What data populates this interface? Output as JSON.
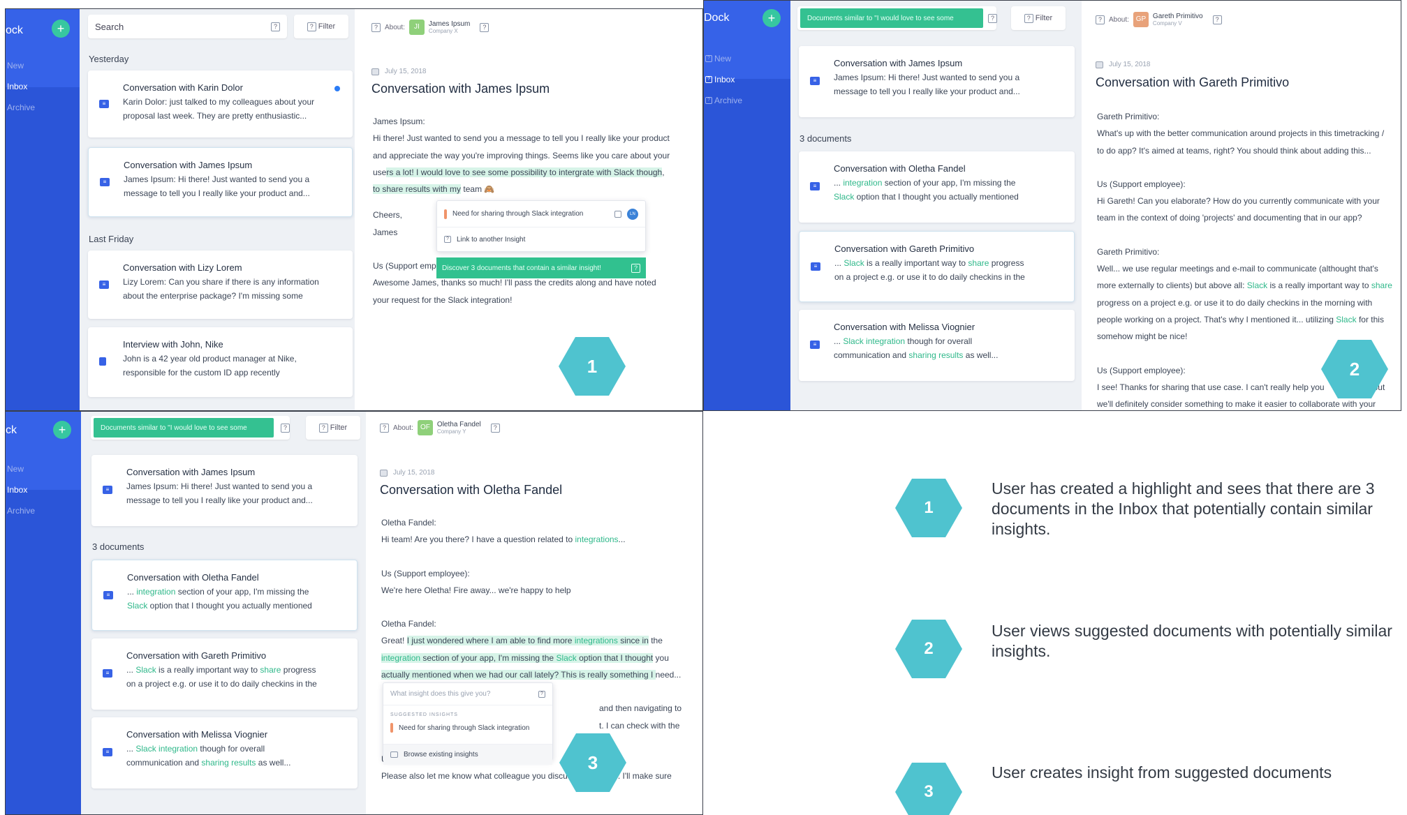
{
  "app": {
    "brand_p1": "ock",
    "brand_p2": "Dock",
    "brand_p3": "ck",
    "add_label": "+"
  },
  "nav": [
    "New",
    "Inbox",
    "Archive"
  ],
  "search": {
    "placeholder": "Search",
    "filter_label": "Filter",
    "similar_chip": "Documents similar to \"I would love to see some"
  },
  "colors": {
    "rail": "#2b55d8",
    "accent_green": "#37c7a0",
    "highlight": "#d7f4e8",
    "hex": "#4fc3cf"
  },
  "panel1": {
    "sections": [
      "Yesterday",
      "Last Friday"
    ],
    "cards": [
      {
        "title": "Conversation with Karin Dolor",
        "l1": "Karin Dolor: just talked to my colleagues about your",
        "l2": "proposal last week. They are pretty enthusiastic..."
      },
      {
        "title": "Conversation with James Ipsum",
        "l1": "James Ipsum: Hi there! Just wanted to send you a",
        "l2": "message to tell you I really like your product and..."
      },
      {
        "title": "Conversation with Lizy Lorem",
        "l1": "Lizy Lorem: Can you share if there is any information",
        "l2": "about the enterprise package? I'm missing some"
      },
      {
        "title": "Interview with John, Nike",
        "l1": "John is a 42 year old product manager at Nike,",
        "l2": "responsible for the custom ID app recently"
      }
    ],
    "about": {
      "label": "About:",
      "initials": "JI",
      "name": "James Ipsum",
      "company": "Company X"
    },
    "date": "July 15, 2018",
    "title": "Conversation with James Ipsum",
    "lines": {
      "a": "James Ipsum:",
      "b": "Hi there! Just wanted to send you a message to tell you I really like your product",
      "c": "and appreciate the way you're improving things. Seems like you care about your",
      "d1": "use",
      "d2": "rs a lot! I would love to see some possibility to intergrate with Slack though",
      "d3": ",",
      "e1": "to share results with my",
      "e2": " team 🙈",
      "f": "Cheers,",
      "g": "James",
      "h": "Us (Support employe",
      "i": "Awesome James, thanks so much! I'll pass the credits along and have noted",
      "j": "your request for the Slack integration!"
    },
    "popup": {
      "insight": "Need for sharing through Slack integration",
      "avatar": "LN",
      "link": "Link to another Insight",
      "discover": "Discover 3 documents  that contain a similar insight!"
    },
    "step": "1"
  },
  "panel2": {
    "section": "3 documents",
    "cards": [
      {
        "title": "Conversation with James Ipsum",
        "l1": "James Ipsum: Hi there! Just wanted to send you a",
        "l2": "message to tell you I really like your product and..."
      },
      {
        "title": "Conversation with Oletha Fandel",
        "l1a": "... ",
        "l1b": "integration",
        "l1c": " section of your app, I'm missing the",
        "l2a": "Slack",
        "l2b": " option that I thought you actually mentioned"
      },
      {
        "title": "Conversation with Gareth Primitivo",
        "l1a": "... ",
        "l1b": "Slack",
        "l1c": " is a really important way to ",
        "l1d": "share",
        "l1e": " progress",
        "l2": "on a project e.g. or use it to do daily checkins in the"
      },
      {
        "title": "Conversation with Melissa Viognier",
        "l1a": "... ",
        "l1b": "Slack integration",
        "l1c": " though for overall",
        "l2a": "communication and ",
        "l2b": "sharing results",
        "l2c": " as well..."
      }
    ],
    "about": {
      "label": "About:",
      "initials": "GP",
      "name": "Gareth Primitivo",
      "company": "Company V"
    },
    "date": "July 15, 2018",
    "title": "Conversation with Gareth Primitivo",
    "lines": {
      "a": "Gareth Primitivo:",
      "b": "What's up with the better communication around projects in this timetracking /",
      "c": "to do app? It's aimed at teams, right? You should think about adding this...",
      "d": "Us (Support employee):",
      "e": "Hi Gareth! Can you elaborate? How do you currently communicate with your",
      "f": "team in the context of doing 'projects' and documenting that in our app?",
      "g": "Gareth Primitivo:",
      "h": "Well... we use regular meetings and e-mail to communicate (althought that's",
      "i1": "more externally to clients) but above all: ",
      "i2": "Slack",
      "i3": " is a really important way to ",
      "i4": "share",
      "j": "progress on a project e.g. or use it to do daily checkins in the morning with",
      "k1": "people working on a project. That's why I mentioned it... utilizing ",
      "k2": "Slack",
      "k3": " for this",
      "l": "somehow might be nice!",
      "m": "Us (Support employee):",
      "n1": "I see! Thanks for sharing that use case. I can't really help you",
      "n2": "but",
      "o": "we'll definitely consider something to make it easier to collaborate with your"
    },
    "step": "2"
  },
  "panel3": {
    "about": {
      "label": "About:",
      "initials": "OF",
      "name": "Oletha Fandel",
      "company": "Company Y"
    },
    "date": "July 15, 2018",
    "title": "Conversation with Oletha Fandel",
    "lines": {
      "a": "Oletha Fandel:",
      "b1": "Hi team! Are you there? I have a question related to ",
      "b2": "integrations",
      "b3": "...",
      "c": "Us (Support employee):",
      "d": "We're here Oletha! Fire away... we're happy to help",
      "e": "Oletha Fandel:",
      "f1": "Great! ",
      "f2": "I just wondered where I am able to find more ",
      "f3": "integrations",
      "f4": " since in",
      "f5": " the",
      "g1": "integration",
      "g2": " section of your app, I'm missing the ",
      "g3": "Slack",
      "g4": " option that I thought",
      "g5": " you",
      "h1": "actually mentioned when we had our call lately? This is really something I ",
      "h2": "need...",
      "i": "and then navigating to",
      "j": "t. I can check with the",
      "k": "Us (Support employee):",
      "l": "Please also let me know what colleague you discussed this with. I'll make sure"
    },
    "popup": {
      "question": "What insight does this give you?",
      "suggested": "SUGGESTED INSIGHTS",
      "insight": "Need for sharing through Slack integration",
      "browse": "Browse existing insights"
    },
    "step": "3"
  },
  "legend": [
    {
      "num": "1",
      "text": "User has created a highlight and sees that there are 3 documents in the Inbox that potentially contain similar insights."
    },
    {
      "num": "2",
      "text": "User views suggested documents with potentially similar insights."
    },
    {
      "num": "3",
      "text": "User creates insight from suggested documents"
    }
  ]
}
